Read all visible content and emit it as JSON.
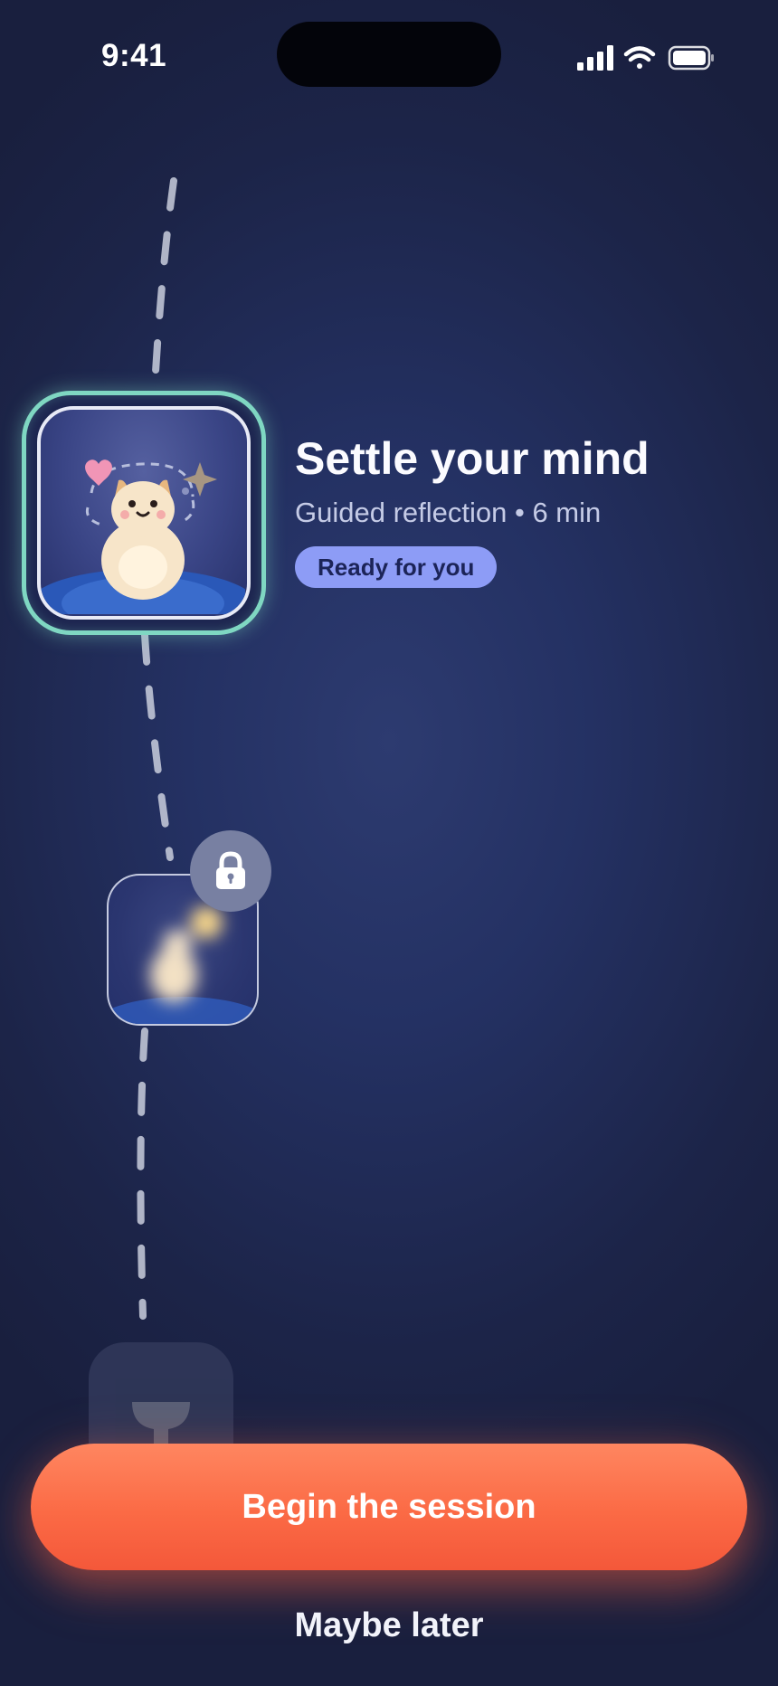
{
  "status_bar": {
    "time": "9:41",
    "icons": [
      "signal-icon",
      "wifi-icon",
      "battery-icon"
    ]
  },
  "session": {
    "title": "Settle your mind",
    "subtitle": "Guided reflection • 6 min",
    "badge": "Ready for you"
  },
  "path_nodes": [
    {
      "name": "current-session",
      "state": "active",
      "icon": "bear-illustration"
    },
    {
      "name": "next-session",
      "state": "locked",
      "icon": "lock-icon"
    },
    {
      "name": "reward",
      "state": "upcoming",
      "icon": "trophy-icon"
    }
  ],
  "actions": {
    "primary": "Begin the session",
    "secondary": "Maybe later"
  },
  "colors": {
    "background": "#1f2850",
    "active_ring": "#7fd7c2",
    "badge": "#8d9cf6",
    "cta": "#fb6a45"
  }
}
